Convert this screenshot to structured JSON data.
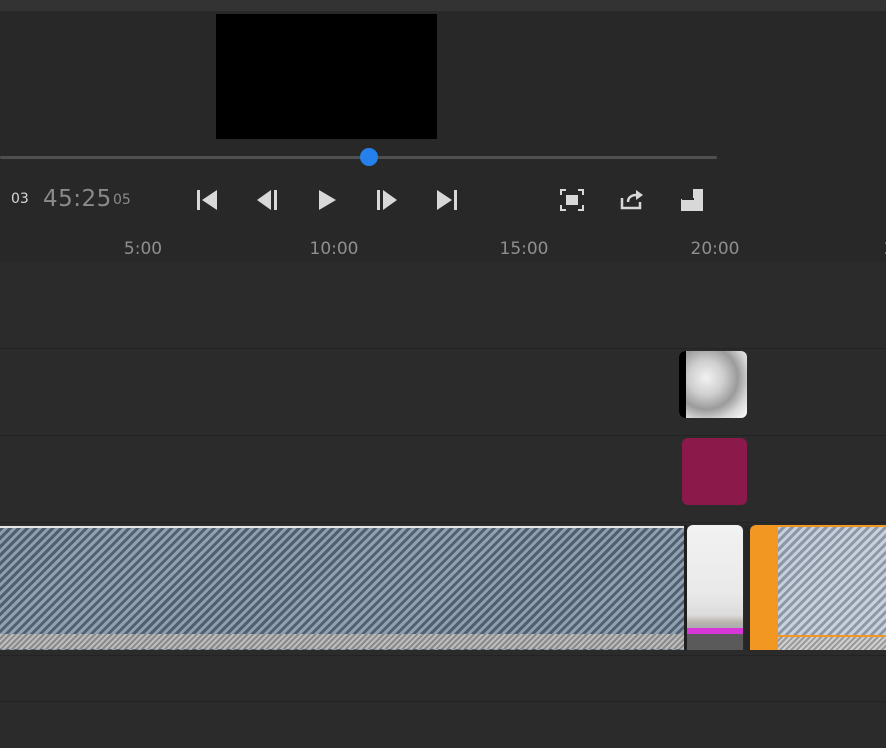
{
  "player": {
    "timecode_current_frames": "03",
    "timecode_total": "45:25",
    "timecode_total_frames": "05",
    "scrub_position": 0.515
  },
  "controls": {
    "skip_start": "skip-to-start-icon",
    "step_back": "step-back-icon",
    "play": "play-icon",
    "step_forward": "step-forward-icon",
    "skip_end": "skip-to-end-icon",
    "fit": "fit-screen-icon",
    "share": "share-icon",
    "layout": "layout-icon"
  },
  "ruler": {
    "labels": [
      "5:00",
      "10:00",
      "15:00",
      "20:00"
    ]
  },
  "colors": {
    "accent": "#2680eb",
    "clip_orange": "#f29822",
    "clip_color": "#8b1a4a",
    "magenta_marker": "#d936d9"
  }
}
